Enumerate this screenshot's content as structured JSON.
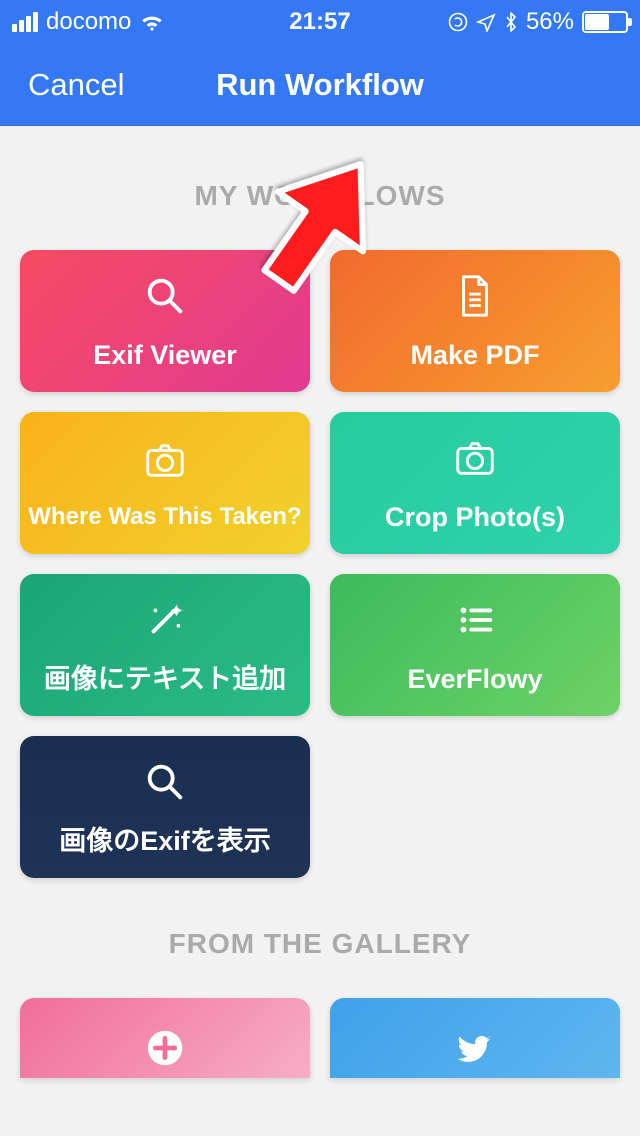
{
  "status": {
    "carrier": "docomo",
    "time": "21:57",
    "battery_percent": "56%"
  },
  "nav": {
    "cancel": "Cancel",
    "title": "Run Workflow"
  },
  "sections": {
    "my_workflows_header": "MY WORKFLOWS",
    "from_gallery_header": "FROM THE GALLERY"
  },
  "workflows": [
    {
      "label": "Exif Viewer",
      "icon": "magnifier",
      "gradient": "grad-pink"
    },
    {
      "label": "Make PDF",
      "icon": "document",
      "gradient": "grad-orange"
    },
    {
      "label": "Where Was This Taken?",
      "icon": "camera",
      "gradient": "grad-yellow",
      "small": true
    },
    {
      "label": "Crop Photo(s)",
      "icon": "camera",
      "gradient": "grad-teal"
    },
    {
      "label": "画像にテキスト追加",
      "icon": "wand",
      "gradient": "grad-darkteal"
    },
    {
      "label": "EverFlowy",
      "icon": "list",
      "gradient": "grad-green"
    },
    {
      "label": "画像のExifを表示",
      "icon": "magnifier",
      "gradient": "grad-navy"
    }
  ],
  "gallery": [
    {
      "icon": "plus",
      "gradient": "grad-pinkish"
    },
    {
      "icon": "twitter",
      "gradient": "grad-blue"
    }
  ]
}
